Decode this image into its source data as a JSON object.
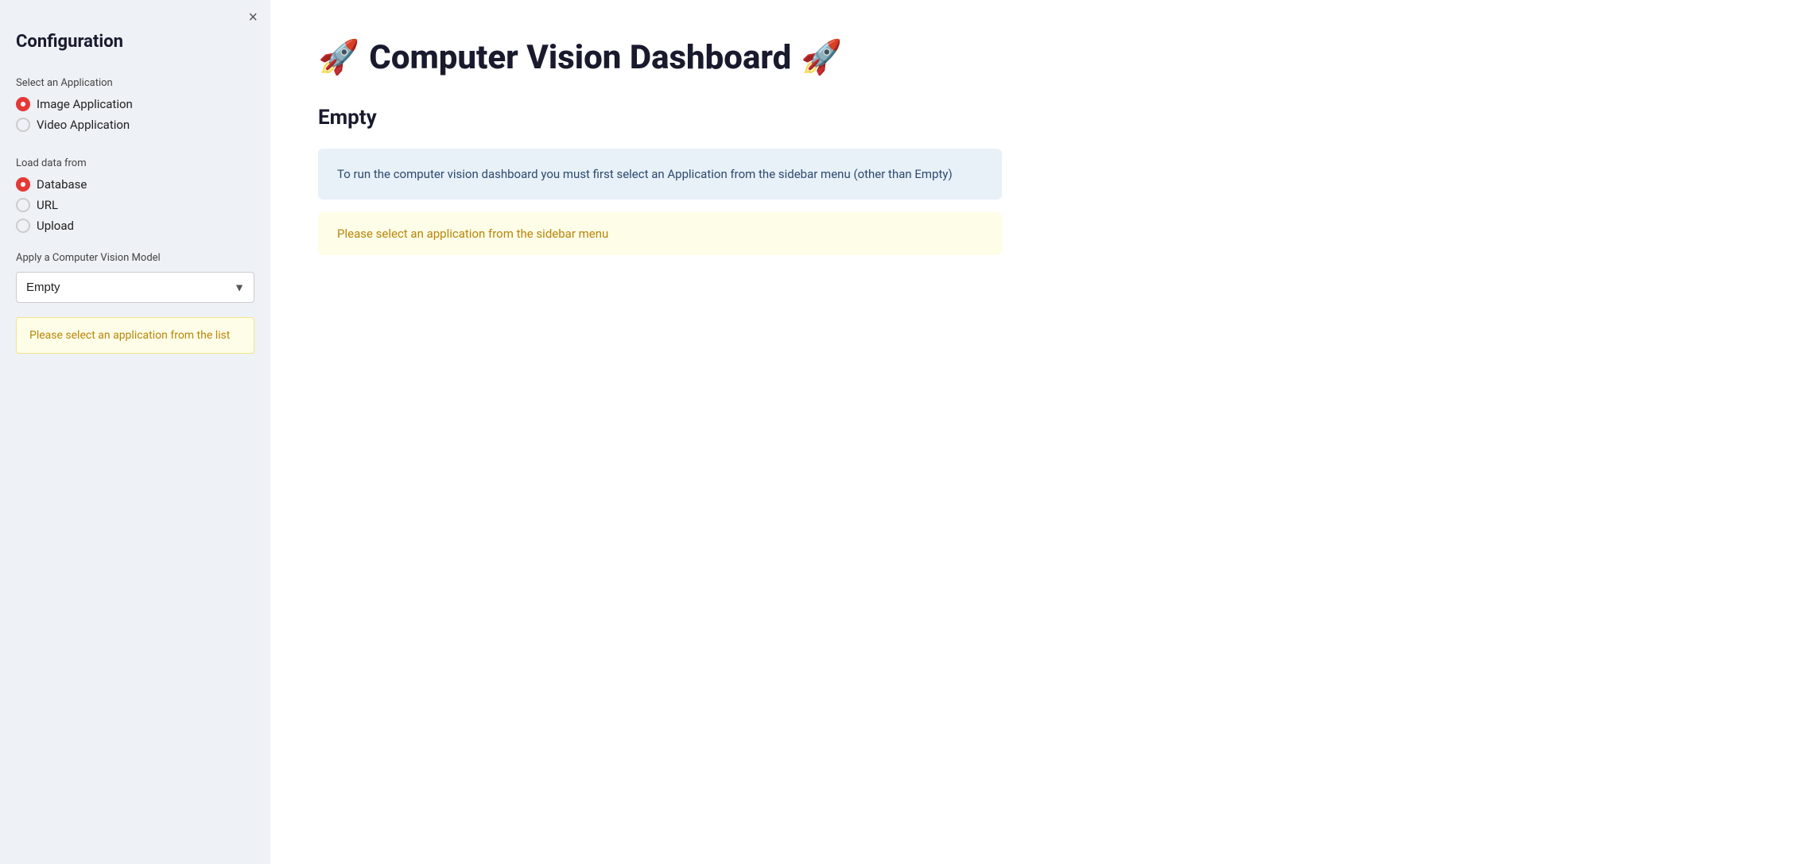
{
  "sidebar": {
    "title": "Configuration",
    "close_label": "×",
    "select_app_label": "Select an Application",
    "app_options": [
      {
        "id": "image",
        "label": "Image Application",
        "checked": true
      },
      {
        "id": "video",
        "label": "Video Application",
        "checked": false
      }
    ],
    "load_data_label": "Load data from",
    "load_data_options": [
      {
        "id": "database",
        "label": "Database",
        "checked": true
      },
      {
        "id": "url",
        "label": "URL",
        "checked": false
      },
      {
        "id": "upload",
        "label": "Upload",
        "checked": false
      }
    ],
    "model_label": "Apply a Computer Vision Model",
    "model_select_value": "Empty",
    "model_options": [
      "Empty"
    ],
    "warning_text": "Please select an application from the list"
  },
  "main": {
    "title_prefix": "🚀",
    "title_text": "Computer Vision Dashboard",
    "title_suffix": "🚀",
    "section_heading": "Empty",
    "info_box_text": "To run the computer vision dashboard you must first select an Application from the sidebar menu (other than Empty)",
    "warning_box_text": "Please select an application from the sidebar menu"
  }
}
